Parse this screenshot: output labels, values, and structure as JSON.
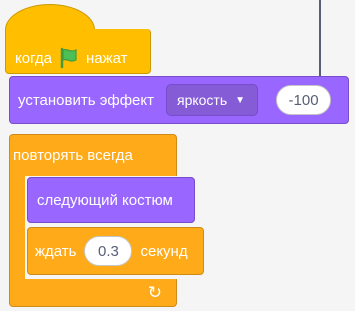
{
  "script": {
    "hat": {
      "label_before": "когда",
      "label_after": "нажат",
      "flag_icon": "green-flag-icon"
    },
    "set_effect": {
      "label": "установить эффект",
      "effect": "яркость",
      "value": "-100"
    },
    "forever": {
      "label": "повторять всегда",
      "loop_icon": "↻"
    },
    "next_costume": {
      "label": "следующий костюм"
    },
    "wait": {
      "label_before": "ждать",
      "value": "0.3",
      "label_after": "секунд"
    }
  },
  "colors": {
    "events": "#ffbf00",
    "looks": "#9966ff",
    "control": "#ffab19",
    "flag": "#4cbf56"
  }
}
